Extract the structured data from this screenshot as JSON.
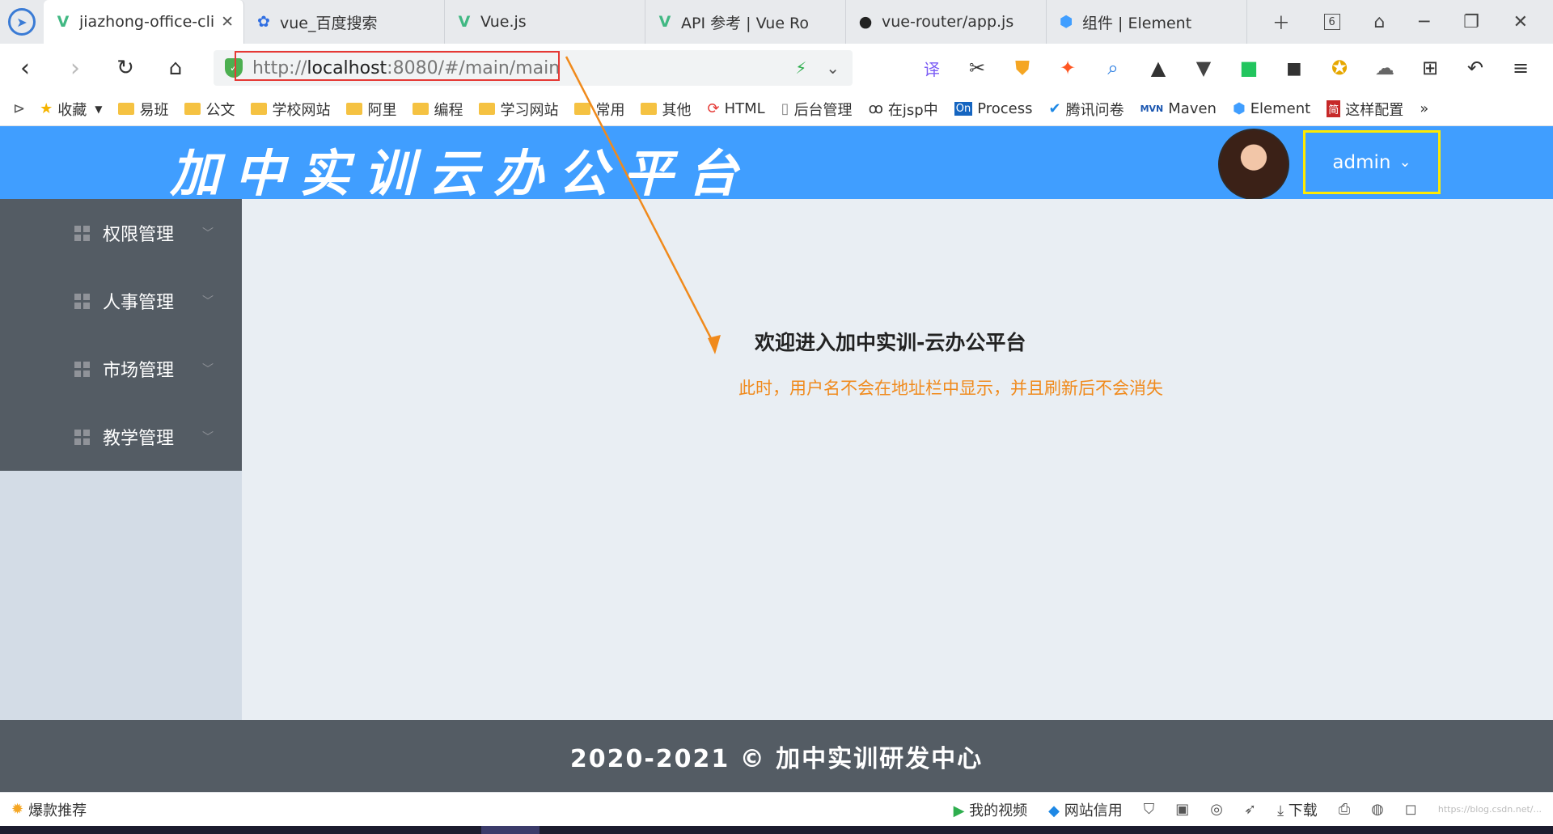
{
  "browser": {
    "tabs": [
      {
        "label": "jiazhong-office-cli",
        "icon": "vue-logo-icon",
        "active": true
      },
      {
        "label": "vue_百度搜索",
        "icon": "baidu-paw-icon"
      },
      {
        "label": "Vue.js",
        "icon": "vue-logo-icon"
      },
      {
        "label": "API 参考 | Vue Ro",
        "icon": "vue-logo-icon"
      },
      {
        "label": "vue-router/app.js",
        "icon": "github-icon"
      },
      {
        "label": "组件 | Element",
        "icon": "element-logo-icon"
      }
    ],
    "tab_count": "6",
    "url_prefix": "http://",
    "url_host": "localhost",
    "url_rest": ":8080/#/main/main",
    "bookmarks": [
      {
        "label": "收藏",
        "icon": "star-icon"
      },
      {
        "label": "易班",
        "icon": "folder-icon"
      },
      {
        "label": "公文",
        "icon": "folder-icon"
      },
      {
        "label": "学校网站",
        "icon": "folder-icon"
      },
      {
        "label": "阿里",
        "icon": "folder-icon"
      },
      {
        "label": "编程",
        "icon": "folder-icon"
      },
      {
        "label": "学习网站",
        "icon": "folder-icon"
      },
      {
        "label": "常用",
        "icon": "folder-icon"
      },
      {
        "label": "其他",
        "icon": "folder-icon"
      },
      {
        "label": "HTML",
        "icon": "html-icon"
      },
      {
        "label": "后台管理",
        "icon": "page-icon"
      },
      {
        "label": "在jsp中",
        "icon": "link-icon"
      },
      {
        "label": "Process",
        "icon": "processon-icon"
      },
      {
        "label": "腾讯问卷",
        "icon": "check-icon"
      },
      {
        "label": "Maven",
        "icon": "maven-icon"
      },
      {
        "label": "Element",
        "icon": "element-logo-icon"
      },
      {
        "label": "这样配置",
        "icon": "jian-icon"
      }
    ],
    "bookmarks_more": "»",
    "ext_translate": "译",
    "status_left": "爆款推荐",
    "status_items": [
      {
        "label": "我的视频",
        "icon": "video-icon"
      },
      {
        "label": "网站信用",
        "icon": "credit-icon"
      },
      {
        "label": "下载",
        "icon": "download-icon"
      }
    ],
    "status_watermark": "https://blog.csdn.net/..."
  },
  "app": {
    "title": "加中实训云办公平台",
    "user_name": "admin",
    "menu": [
      {
        "label": "权限管理"
      },
      {
        "label": "人事管理"
      },
      {
        "label": "市场管理"
      },
      {
        "label": "教学管理"
      }
    ],
    "welcome": "欢迎进入加中实训-云办公平台",
    "note": "此时，用户名不会在地址栏中显示，并且刷新后不会消失",
    "footer": "2020-2021 © 加中实训研发中心"
  },
  "colors": {
    "header": "#409eff",
    "sidebar_menu": "#545c64",
    "sidebar_bg": "#d3dce6",
    "main_bg": "#e9eef3",
    "footer": "#545c64",
    "note": "#f08a1c",
    "url_highlight": "#e53935",
    "user_highlight": "#ffea00"
  }
}
